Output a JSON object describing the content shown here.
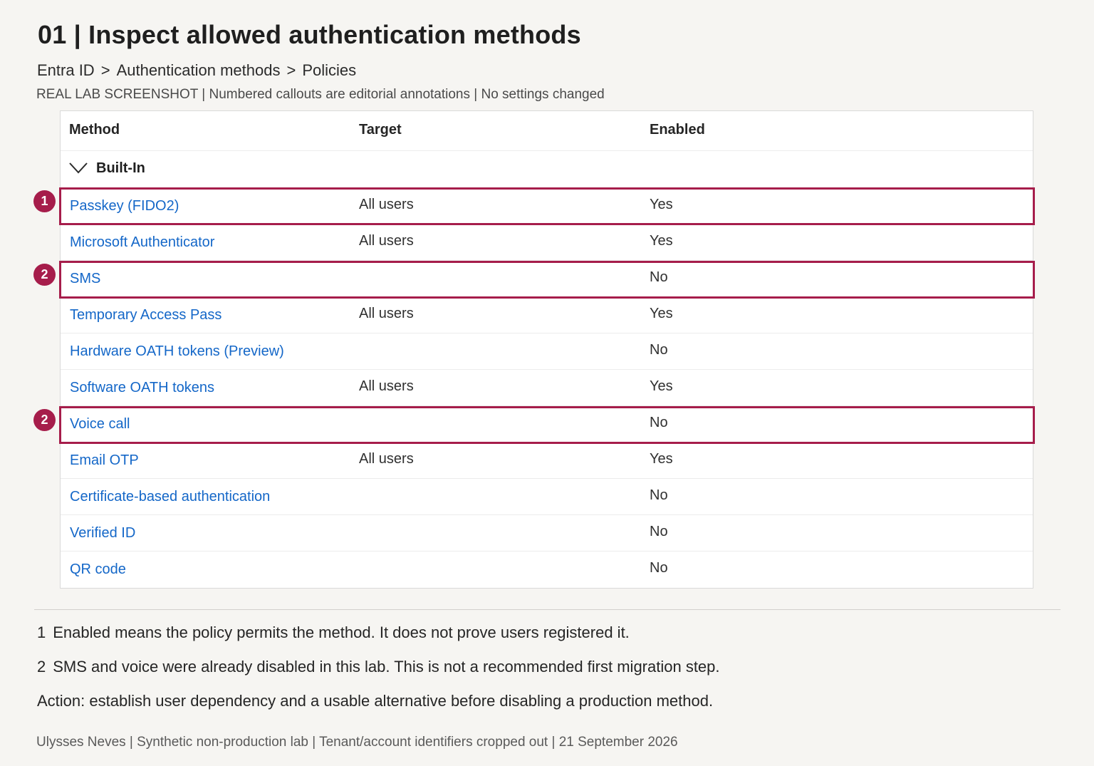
{
  "header": {
    "title": "01 | Inspect allowed authentication methods",
    "breadcrumb": [
      "Entra ID",
      "Authentication methods",
      "Policies"
    ],
    "breadcrumb_separator": ">",
    "subtitle": "REAL LAB SCREENSHOT | Numbered callouts are editorial annotations | No settings changed"
  },
  "table": {
    "columns": {
      "method": "Method",
      "target": "Target",
      "enabled": "Enabled"
    },
    "group": "Built-In",
    "rows": [
      {
        "method": "Passkey (FIDO2)",
        "target": "All users",
        "enabled": "Yes"
      },
      {
        "method": "Microsoft Authenticator",
        "target": "All users",
        "enabled": "Yes"
      },
      {
        "method": "SMS",
        "target": "",
        "enabled": "No"
      },
      {
        "method": "Temporary Access Pass",
        "target": "All users",
        "enabled": "Yes"
      },
      {
        "method": "Hardware OATH tokens (Preview)",
        "target": "",
        "enabled": "No"
      },
      {
        "method": "Software OATH tokens",
        "target": "All users",
        "enabled": "Yes"
      },
      {
        "method": "Voice call",
        "target": "",
        "enabled": "No"
      },
      {
        "method": "Email OTP",
        "target": "All users",
        "enabled": "Yes"
      },
      {
        "method": "Certificate-based authentication",
        "target": "",
        "enabled": "No"
      },
      {
        "method": "Verified ID",
        "target": "",
        "enabled": "No"
      },
      {
        "method": "QR code",
        "target": "",
        "enabled": "No"
      }
    ]
  },
  "callouts": [
    {
      "number": "1",
      "row": "Passkey (FIDO2)"
    },
    {
      "number": "2",
      "row": "SMS"
    },
    {
      "number": "2",
      "row": "Voice call"
    }
  ],
  "notes": [
    {
      "number": "1",
      "text": "Enabled means the policy permits the method. It does not prove users registered it."
    },
    {
      "number": "2",
      "text": "SMS and voice were already disabled in this lab. This is not a recommended first migration step."
    },
    {
      "number": "",
      "text": "Action: establish user dependency and a usable alternative before disabling a production method."
    }
  ],
  "footer": "Ulysses Neves | Synthetic non-production lab | Tenant/account identifiers cropped out | 21 September 2026",
  "colors": {
    "accent": "#a61d4b",
    "link": "#1467c8",
    "background": "#f6f5f2"
  }
}
